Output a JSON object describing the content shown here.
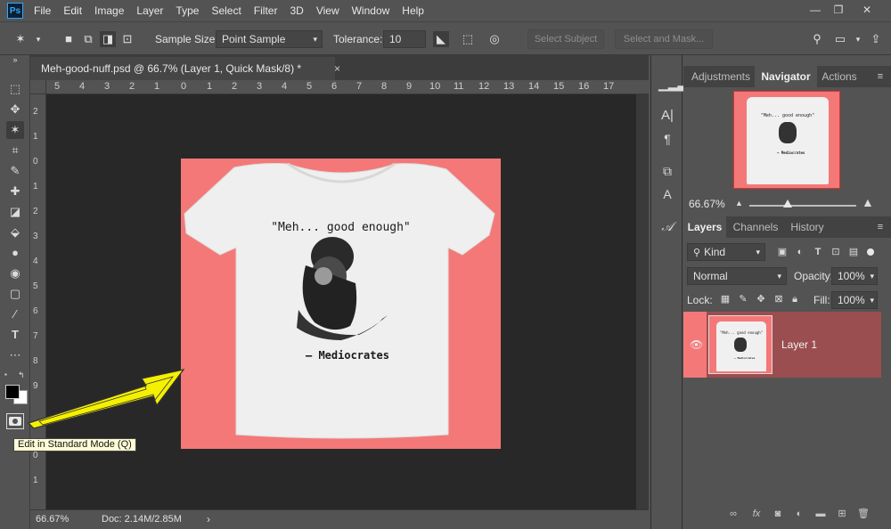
{
  "app": {
    "logo": "Ps"
  },
  "menu": [
    "File",
    "Edit",
    "Image",
    "Layer",
    "Type",
    "Select",
    "Filter",
    "3D",
    "View",
    "Window",
    "Help"
  ],
  "window_controls": {
    "minimize": "—",
    "restore": "❐",
    "close": "✕"
  },
  "options_bar": {
    "sample_size_label": "Sample Size:",
    "sample_size_value": "Point Sample",
    "tolerance_label": "Tolerance:",
    "tolerance_value": "10",
    "select_subject": "Select Subject",
    "select_and_mask": "Select and Mask..."
  },
  "document": {
    "tab_title": "Meh-good-nuff.psd @ 66.7% (Layer 1, Quick Mask/8) *",
    "tab_close": "×",
    "ruler_h": [
      "5",
      "4",
      "3",
      "2",
      "1",
      "0",
      "1",
      "2",
      "3",
      "4",
      "5",
      "6",
      "7",
      "8",
      "9",
      "10",
      "11",
      "12",
      "13",
      "14",
      "15",
      "16",
      "17"
    ],
    "ruler_v": [
      "2",
      "1",
      "0",
      "1",
      "2",
      "3",
      "4",
      "5",
      "6",
      "7",
      "8",
      "9",
      "0",
      "1"
    ],
    "artwork": {
      "quote": "\"Meh... good enough\"",
      "attribution": "– Mediocrates",
      "background_color": "#f47878"
    }
  },
  "status": {
    "zoom": "66.67%",
    "doc_size": "Doc: 2.14M/2.85M",
    "arrow": "›"
  },
  "tooltip": "Edit in Standard Mode (Q)",
  "navigator_panel": {
    "tabs": [
      "Adjustments",
      "Navigator",
      "Actions"
    ],
    "active_tab": "Navigator",
    "zoom": "66.67%",
    "zoom_slider_value": 0.36,
    "thumb_quote": "\"Meh... good enough\"",
    "thumb_attr": "– Mediocrates"
  },
  "layers_panel": {
    "tabs": [
      "Layers",
      "Channels",
      "History"
    ],
    "active_tab": "Layers",
    "filter_label": "Kind",
    "blend_mode": "Normal",
    "opacity_label": "Opacity:",
    "opacity_value": "100%",
    "lock_label": "Lock:",
    "fill_label": "Fill:",
    "fill_value": "100%",
    "layers": [
      {
        "name": "Layer 1",
        "visible": true,
        "thumb_quote": "\"Meh... good enough\"",
        "thumb_attr": "– Mediocrates"
      }
    ]
  },
  "colors": {
    "accent_ps": "#31a8ff",
    "artboard": "#f47878",
    "layer_selected": "#9b4e4f",
    "annotation_arrow": "#f5f000"
  }
}
